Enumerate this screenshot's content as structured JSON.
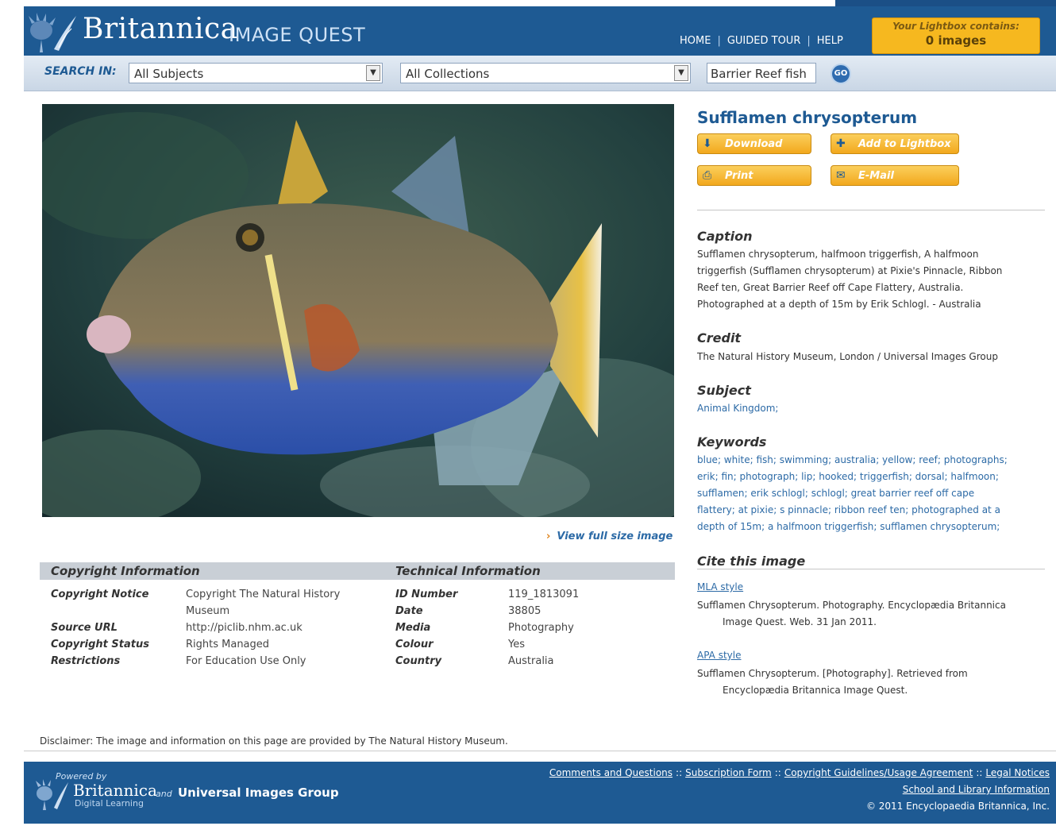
{
  "header": {
    "brand": "Britannica",
    "brand_sub": "IMAGE QUEST",
    "nav": [
      "HOME",
      "GUIDED TOUR",
      "HELP"
    ],
    "lightbox_line1": "Your Lightbox contains:",
    "lightbox_line2": "0 images"
  },
  "search": {
    "label": "SEARCH IN:",
    "subjects_value": "All Subjects",
    "collections_value": "All Collections",
    "query": "Barrier Reef fish",
    "go_label": "GO"
  },
  "image": {
    "view_full_label": "View full size image"
  },
  "details": {
    "title": "Sufflamen chrysopterum",
    "buttons": {
      "download": "Download",
      "add_lightbox": "Add to Lightbox",
      "print": "Print",
      "email": "E-Mail"
    },
    "caption_heading": "Caption",
    "caption_lines": [
      "Sufflamen chrysopterum, halfmoon triggerfish, A halfmoon",
      "triggerfish (Sufflamen chrysopterum) at Pixie's Pinnacle, Ribbon",
      "Reef ten, Great Barrier Reef off Cape Flattery, Australia.",
      "Photographed at a depth of 15m by Erik Schlogl. - Australia"
    ],
    "credit_heading": "Credit",
    "credit_text": "The Natural History Museum, London / Universal Images Group",
    "subject_heading": "Subject",
    "subject_text": "Animal Kingdom;",
    "keywords_heading": "Keywords",
    "keywords_lines": [
      "blue; white; fish; swimming; australia; yellow; reef; photographs;",
      "erik; fin; photograph; lip; hooked; triggerfish; dorsal; halfmoon;",
      "sufflamen; erik schlogl; schlogl; great barrier reef off cape",
      "flattery; at pixie; s pinnacle; ribbon reef ten; photographed at a",
      "depth of 15m; a halfmoon triggerfish; sufflamen chrysopterum;"
    ],
    "cite_heading": "Cite this image",
    "mla_label": "MLA style",
    "mla_line1": "Sufflamen Chrysopterum. Photography. Encyclopædia Britannica",
    "mla_line2": "Image Quest. Web. 31 Jan 2011.",
    "apa_label": "APA style",
    "apa_line1": "Sufflamen Chrysopterum. [Photography]. Retrieved from",
    "apa_line2": "Encyclopædia Britannica Image Quest."
  },
  "info": {
    "copyright_heading": "Copyright Information",
    "technical_heading": "Technical Information",
    "copyright_rows": [
      {
        "label": "Copyright Notice",
        "value": "Copyright The Natural History",
        "value2": "Museum"
      },
      {
        "label": "Source URL",
        "value": "http://piclib.nhm.ac.uk"
      },
      {
        "label": "Copyright Status",
        "value": "Rights Managed"
      },
      {
        "label": "Restrictions",
        "value": "For Education Use Only"
      }
    ],
    "technical_rows": [
      {
        "label": "ID Number",
        "value": "119_1813091"
      },
      {
        "label": "Date",
        "value": "38805"
      },
      {
        "label": "Media",
        "value": "Photography"
      },
      {
        "label": "Colour",
        "value": "Yes"
      },
      {
        "label": "Country",
        "value": "Australia"
      }
    ]
  },
  "disclaimer": "Disclaimer: The image and information on this page are provided by The Natural History Museum.",
  "footer": {
    "powered_by": "Powered by",
    "brand": "Britannica",
    "brand_sub": "Digital Learning",
    "and": "and",
    "partner": "Universal Images Group",
    "links": [
      "Comments and Questions",
      "Subscription Form",
      "Copyright Guidelines/Usage Agreement",
      "Legal Notices"
    ],
    "school_link": "School and Library Information",
    "copyright": "© 2011 Encyclopaedia Britannica, Inc."
  },
  "colors": {
    "header_blue": "#1e5a93",
    "accent_orange": "#f2a81d",
    "link_blue": "#2c6aa6"
  }
}
